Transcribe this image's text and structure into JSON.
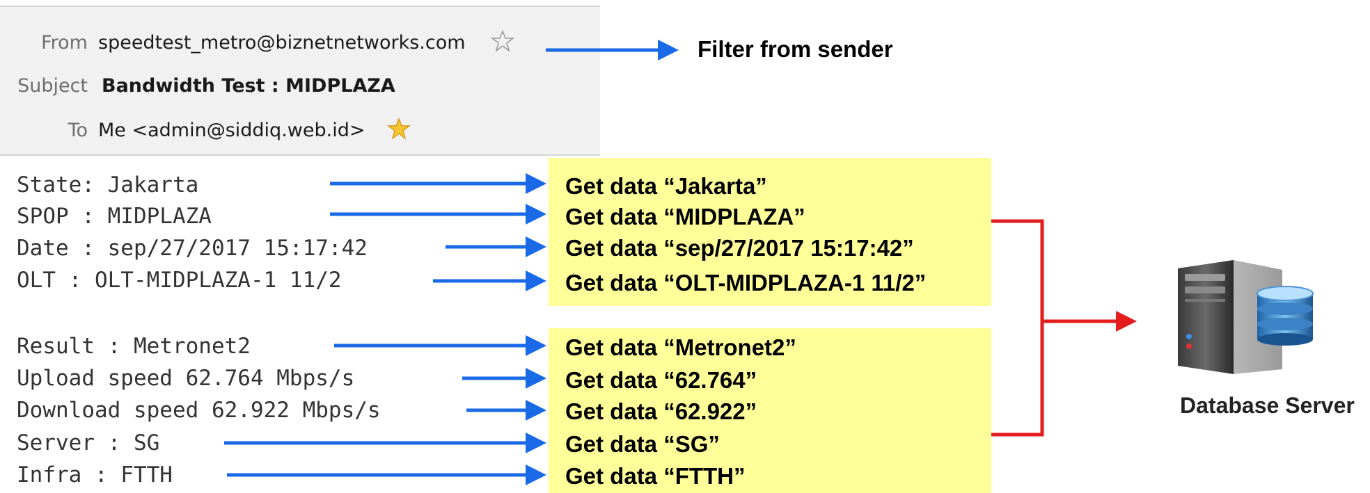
{
  "email": {
    "from_label": "From",
    "from_value": "speedtest_metro@biznetnetworks.com",
    "subject_label": "Subject",
    "subject_value": "Bandwidth Test : MIDPLAZA",
    "to_label": "To",
    "to_value": "Me <admin@siddiq.web.id>"
  },
  "filter_note": "Filter from sender",
  "body_lines": [
    "State: Jakarta",
    "SPOP : MIDPLAZA",
    "Date : sep/27/2017 15:17:42",
    "OLT : OLT-MIDPLAZA-1 11/2",
    "Result : Metronet2",
    "Upload speed 62.764 Mbps/s",
    "Download speed 62.922 Mbps/s",
    "Server : SG",
    "Infra : FTTH"
  ],
  "notes": [
    "Get data “Jakarta”",
    "Get data “MIDPLAZA”",
    "Get data “sep/27/2017 15:17:42”",
    "Get data “OLT-MIDPLAZA-1 11/2”",
    "Get data “Metronet2”",
    "Get data “62.764”",
    "Get data  “62.922”",
    "Get data  “SG”",
    "Get data  “FTTH”"
  ],
  "database_label": "Database Server",
  "colors": {
    "arrow_blue": "#1a6ae8",
    "arrow_red": "#e51c1c",
    "note_yellow": "#ffff99",
    "header_bg": "#f1f1f1"
  }
}
